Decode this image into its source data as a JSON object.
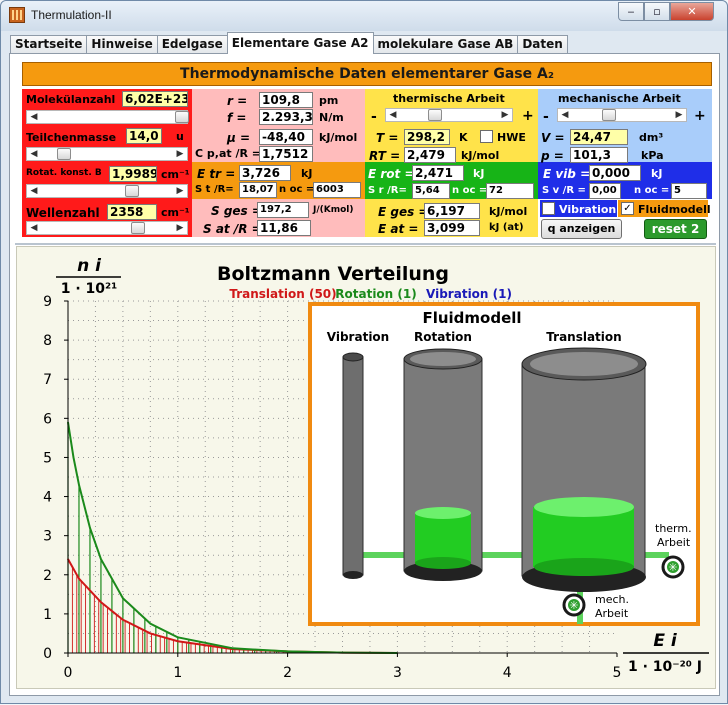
{
  "window": {
    "title": "Thermulation-II",
    "min": "‒",
    "max": "▫",
    "close": "✕"
  },
  "tabs": [
    "Startseite",
    "Hinweise",
    "Edelgase",
    "Elementare Gase A2",
    "molekulare Gase AB",
    "Daten"
  ],
  "header": "Thermodynamische Daten elementarer Gase A₂",
  "colors": {
    "red": "#ff1a1a",
    "pink": "#ffbcbc",
    "yellow": "#ffe34a",
    "lightblue": "#a9cdfa",
    "orange": "#f59a0f",
    "green": "#17b417",
    "blue": "#1f2ee8",
    "translation": "#d01818",
    "rotation": "#1b8a1b",
    "vibration": "#1a1ab8"
  },
  "col1": {
    "molecules_label": "Molekülanzahl",
    "molecules_value": "6,02E+23",
    "mass_label": "Teilchenmasse",
    "mass_value": "14,0",
    "mass_unit": "u",
    "rot_label": "Rotat. konst. B",
    "rot_value": "1,9989",
    "rot_unit": "cm⁻¹",
    "wave_label": "Wellenzahl",
    "wave_value": "2358",
    "wave_unit": "cm⁻¹"
  },
  "col2": {
    "r_label": "r =",
    "r_value": "109,8",
    "r_unit": "pm",
    "f_label": "f =",
    "f_value": "2.293,3",
    "f_unit": "N/m",
    "mu_label": "μ =",
    "mu_value": "-48,40",
    "mu_unit": "kJ/mol",
    "cp_label": "C p,at /R =",
    "cp_value": "1,7512",
    "etr_label": "E tr =",
    "etr_value": "3,726",
    "etr_unit": "kJ",
    "st_label": "S t /R=",
    "st_value": "18,07",
    "noc_label": "n oc =",
    "noc_value": "6003",
    "sges_label": "S ges =",
    "sges_value": "197,2",
    "sges_unit": "J/(Kmol)",
    "sat_label": "S at /R =",
    "sat_value": "11,86"
  },
  "col3": {
    "title": "thermische Arbeit",
    "minus": "-",
    "plus": "+",
    "T_label": "T =",
    "T_value": "298,2",
    "T_unit": "K",
    "hwe_label": "HWE",
    "RT_label": "RT =",
    "RT_value": "2,479",
    "RT_unit": "kJ/mol",
    "erot_label": "E rot =",
    "erot_value": "2,471",
    "erot_unit": "kJ",
    "sr_label": "S r /R=",
    "sr_value": "5,64",
    "noc_label": "n oc =",
    "noc_value": "72",
    "eges_label": "E ges =",
    "eges_value": "6,197",
    "eges_unit": "kJ/mol",
    "eat_label": "E at =",
    "eat_value": "3,099",
    "eat_unit": "kJ (at)"
  },
  "col4": {
    "title": "mechanische Arbeit",
    "minus": "-",
    "plus": "+",
    "V_label": "V =",
    "V_value": "24,47",
    "V_unit": "dm³",
    "p_label": "p =",
    "p_value": "101,3",
    "p_unit": "kPa",
    "evib_label": "E vib =",
    "evib_value": "0,000",
    "evib_unit": "kJ",
    "sv_label": "S v /R =",
    "sv_value": "0,00",
    "noc_label": "n oc =",
    "noc_value": "5",
    "vibration_label": "Vibration",
    "fluid_label": "Fluidmodell",
    "q_button": "q anzeigen",
    "reset_button": "reset 2"
  },
  "chart": {
    "title": "Boltzmann Verteilung",
    "legend_translation": "Translation (50)",
    "legend_rotation": "Rotation (1)",
    "legend_vibration": "Vibration (1)",
    "ylabel_top": "n i",
    "ylabel_bottom": "1 · 10²¹",
    "xlabel_top": "E i",
    "xlabel_bottom": "1 · 10⁻²⁰ J"
  },
  "fluid": {
    "title": "Fluidmodell",
    "vibration": "Vibration",
    "rotation": "Rotation",
    "translation": "Translation",
    "therm_label": "therm.",
    "therm_label2": "Arbeit",
    "mech_label": "mech.",
    "mech_label2": "Arbeit"
  },
  "chart_data": {
    "type": "line",
    "title": "Boltzmann Verteilung",
    "xlabel": "E i / 1·10⁻²⁰ J",
    "ylabel": "n i / 1·10²¹",
    "xlim": [
      0,
      5
    ],
    "ylim": [
      0,
      9
    ],
    "xticks": [
      0,
      1,
      2,
      3,
      4,
      5
    ],
    "yticks": [
      0,
      1,
      2,
      3,
      4,
      5,
      6,
      7,
      8,
      9
    ],
    "grid": true,
    "series": [
      {
        "name": "Translation (50)",
        "x": [
          0,
          0.1,
          0.2,
          0.3,
          0.5,
          0.75,
          1.0,
          1.5,
          2.0,
          2.5,
          3.0
        ],
        "values": [
          2.4,
          1.9,
          1.6,
          1.3,
          0.85,
          0.5,
          0.3,
          0.1,
          0.04,
          0.01,
          0.0
        ]
      },
      {
        "name": "Rotation (1)",
        "x": [
          0,
          0.05,
          0.1,
          0.2,
          0.3,
          0.5,
          0.75,
          1.0,
          1.5,
          2.0,
          2.5,
          3.0
        ],
        "values": [
          5.9,
          5.0,
          4.3,
          3.2,
          2.4,
          1.4,
          0.75,
          0.4,
          0.12,
          0.04,
          0.01,
          0.0
        ]
      }
    ],
    "legend_placement": "top"
  }
}
